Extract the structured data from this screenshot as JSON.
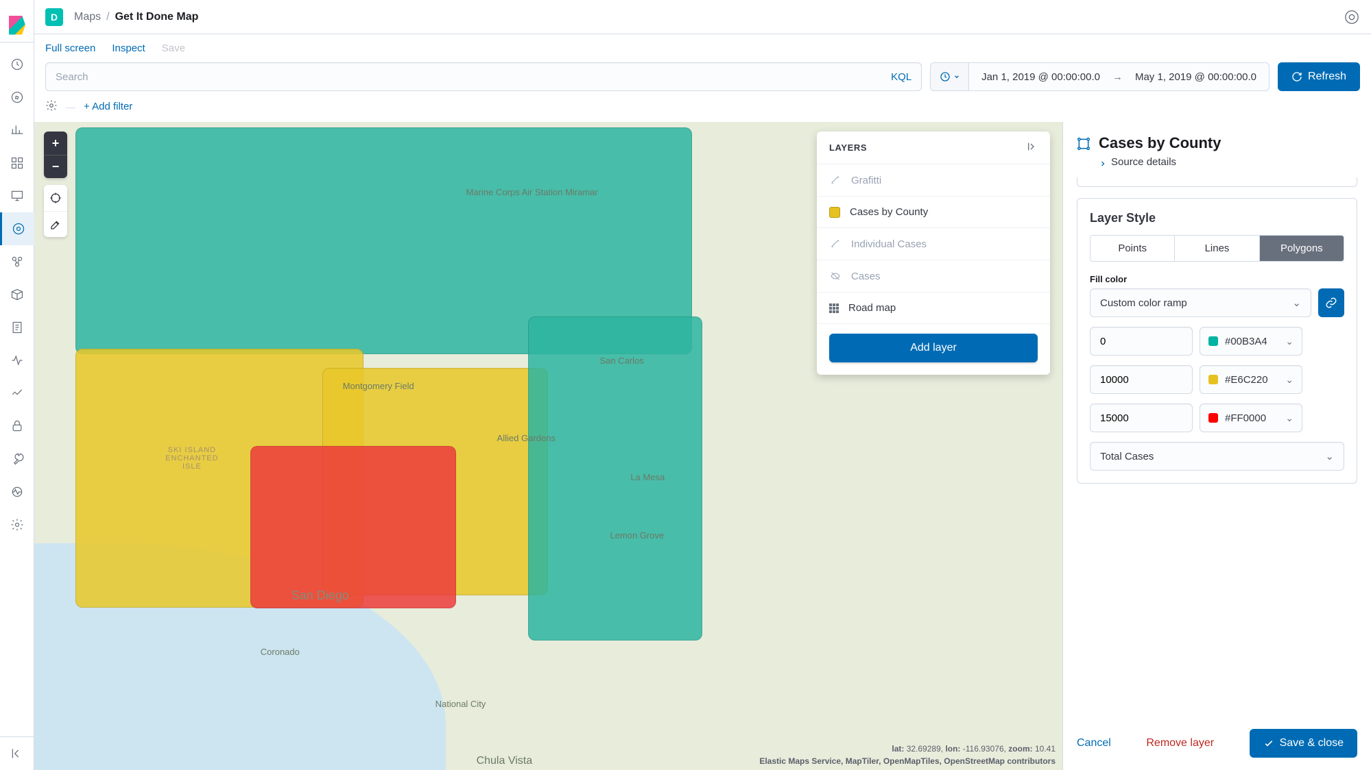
{
  "header": {
    "space_letter": "D",
    "breadcrumb_root": "Maps",
    "breadcrumb_current": "Get It Done Map"
  },
  "toolbar": {
    "fullscreen": "Full screen",
    "inspect": "Inspect",
    "save": "Save",
    "search_placeholder": "Search",
    "kql": "KQL",
    "date_from": "Jan 1, 2019 @ 00:00:00.0",
    "date_to": "May 1, 2019 @ 00:00:00.0",
    "refresh": "Refresh",
    "add_filter": "+ Add filter"
  },
  "map": {
    "layers_title": "LAYERS",
    "layers": {
      "grafitti": "Grafitti",
      "cases_by_county": "Cases by County",
      "individual_cases": "Individual Cases",
      "cases": "Cases",
      "road_map": "Road map"
    },
    "add_layer": "Add layer",
    "labels": {
      "miramar": "Marine Corps Air Station Miramar",
      "montgomery": "Montgomery Field",
      "allied": "Allied Gardens",
      "san_carlos": "San Carlos",
      "la_mesa": "La Mesa",
      "lemon_grove": "Lemon Grove",
      "san_diego": "San Diego",
      "coronado": "Coronado",
      "national_city": "National City",
      "chula_vista": "Chula Vista",
      "ski_island": "SKI ISLAND ENCHANTED ISLE"
    },
    "coords": {
      "lat_label": "lat:",
      "lat": "32.69289,",
      "lon_label": "lon:",
      "lon": "-116.93076,",
      "zoom_label": "zoom:",
      "zoom": "10.41"
    },
    "attribution": "Elastic Maps Service, MapTiler, OpenMapTiles, OpenStreetMap contributors"
  },
  "editor": {
    "title": "Cases by County",
    "source_details": "Source details",
    "layer_style_title": "Layer Style",
    "tabs": {
      "points": "Points",
      "lines": "Lines",
      "polygons": "Polygons"
    },
    "fill_color_label": "Fill color",
    "ramp_type": "Custom color ramp",
    "ramps": [
      {
        "stop": "0",
        "hex": "#00B3A4",
        "swatch": "#00B3A4"
      },
      {
        "stop": "10000",
        "hex": "#E6C220",
        "swatch": "#E6C220"
      },
      {
        "stop": "15000",
        "hex": "#FF0000",
        "swatch": "#FF0000"
      }
    ],
    "field_select": "Total Cases",
    "cancel": "Cancel",
    "remove": "Remove layer",
    "save_close": "Save & close"
  },
  "chart_data": {
    "type": "choropleth",
    "title": "Cases by County",
    "color_field": "Total Cases",
    "color_stops": [
      {
        "value": 0,
        "color": "#00B3A4"
      },
      {
        "value": 10000,
        "color": "#E6C220"
      },
      {
        "value": 15000,
        "color": "#FF0000"
      }
    ],
    "regions_visible": [
      "Marine Corps Air Station Miramar",
      "Montgomery Field",
      "Allied Gardens",
      "San Carlos",
      "La Mesa",
      "Lemon Grove",
      "San Diego",
      "Coronado",
      "National City",
      "Chula Vista"
    ],
    "center": {
      "lat": 32.69289,
      "lon": -116.93076
    },
    "zoom": 10.41
  }
}
